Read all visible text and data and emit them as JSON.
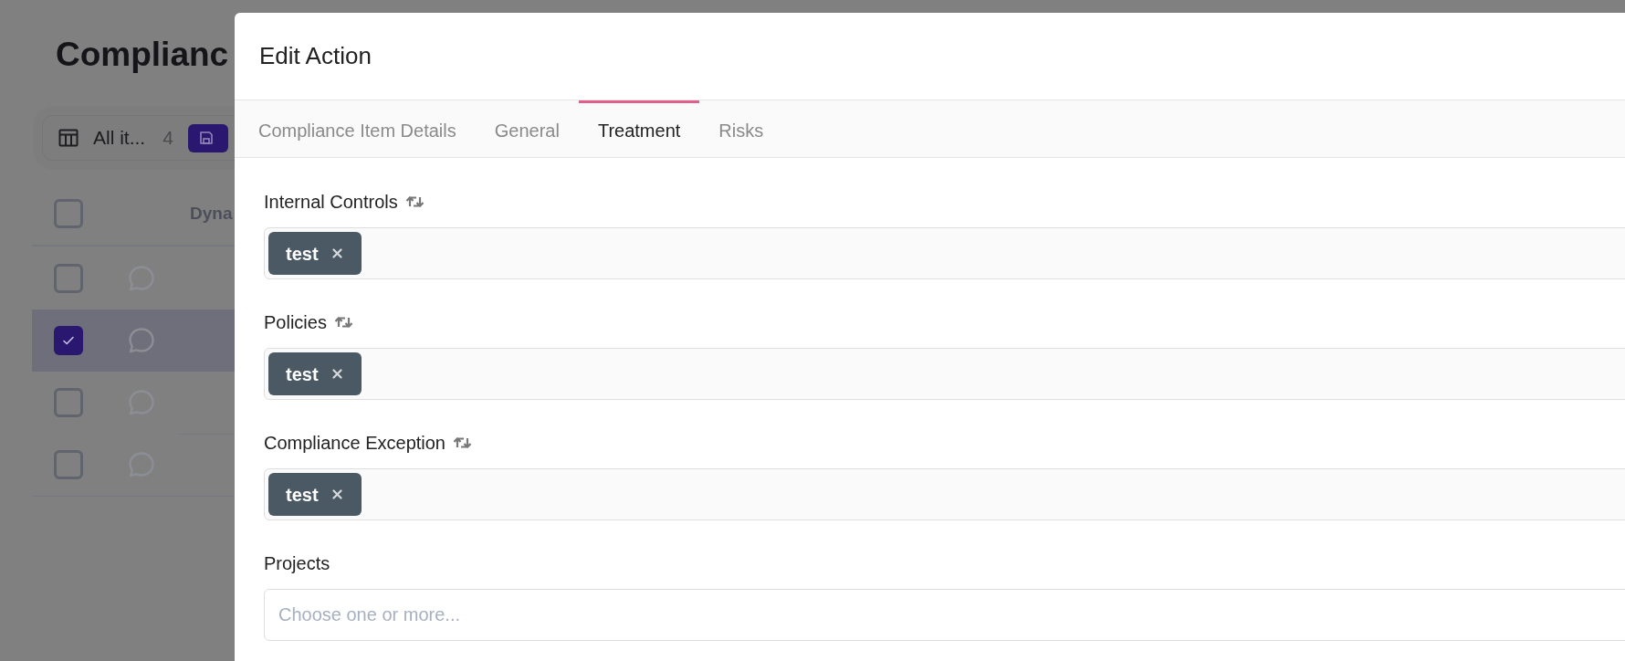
{
  "background_page": {
    "title": "Complianc",
    "view_bar": {
      "label": "All it...",
      "count": "4"
    },
    "table": {
      "header": {
        "checked": false,
        "column_2": "Dyna"
      },
      "rows": [
        {
          "checked": false
        },
        {
          "checked": true
        },
        {
          "checked": false
        },
        {
          "checked": false
        }
      ]
    }
  },
  "modal": {
    "title": "Edit Action",
    "tabs": [
      {
        "label": "Compliance Item Details",
        "selected": false
      },
      {
        "label": "General",
        "selected": false
      },
      {
        "label": "Treatment",
        "selected": true
      },
      {
        "label": "Risks",
        "selected": false
      }
    ],
    "fields": [
      {
        "label": "Internal Controls",
        "sync": true,
        "tags": [
          "test"
        ]
      },
      {
        "label": "Policies",
        "sync": true,
        "tags": [
          "test"
        ]
      },
      {
        "label": "Compliance Exception",
        "sync": true,
        "tags": [
          "test"
        ]
      },
      {
        "label": "Projects",
        "sync": false,
        "placeholder": "Choose one or more..."
      }
    ]
  }
}
